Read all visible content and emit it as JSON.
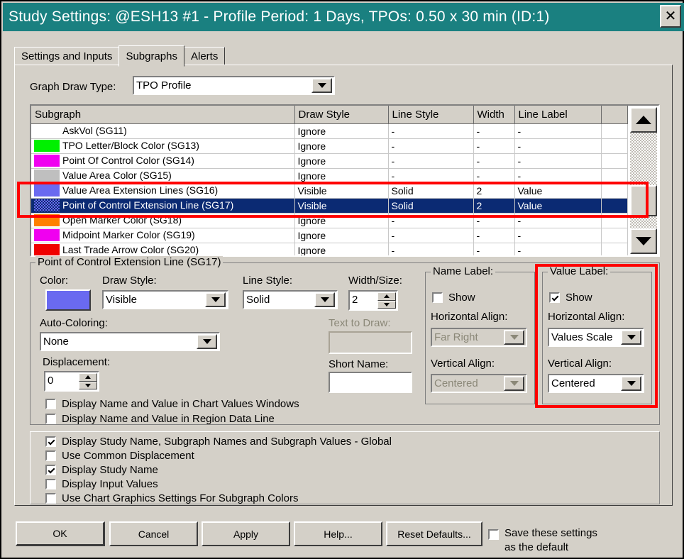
{
  "window": {
    "title": "Study Settings: @ESH13  #1 - Profile Period: 1 Days, TPOs: 0.50 x 30 min   (ID:1)",
    "close_label": "✕"
  },
  "tabs": [
    {
      "label": "Settings and Inputs",
      "active": false
    },
    {
      "label": "Subgraphs",
      "active": true
    },
    {
      "label": "Alerts",
      "active": false
    }
  ],
  "graph_draw_type": {
    "label": "Graph Draw Type:",
    "value": "TPO Profile"
  },
  "table": {
    "headers": [
      "Subgraph",
      "Draw Style",
      "Line Style",
      "Width",
      "Line Label",
      ""
    ],
    "rows": [
      {
        "swatch": "",
        "name": "AskVol (SG11)",
        "draw_style": "Ignore",
        "line_style": "-",
        "width": "-",
        "line_label": "-",
        "extra": "",
        "selected": false
      },
      {
        "swatch": "#00f000",
        "name": "TPO Letter/Block Color (SG13)",
        "draw_style": "Ignore",
        "line_style": "-",
        "width": "-",
        "line_label": "-",
        "extra": "",
        "selected": false
      },
      {
        "swatch": "#f000f0",
        "name": "Point Of Control Color (SG14)",
        "draw_style": "Ignore",
        "line_style": "-",
        "width": "-",
        "line_label": "-",
        "extra": "",
        "selected": false
      },
      {
        "swatch": "#bfbfbf",
        "name": "Value Area Color (SG15)",
        "draw_style": "Ignore",
        "line_style": "-",
        "width": "-",
        "line_label": "-",
        "extra": "",
        "selected": false
      },
      {
        "swatch": "#6a6af0",
        "name": "Value Area Extension Lines (SG16)",
        "draw_style": "Visible",
        "line_style": "Solid",
        "width": "2",
        "line_label": "Value",
        "extra": "",
        "selected": false
      },
      {
        "swatch": "#6a6af0",
        "name": "Point of Control Extension Line (SG17)",
        "draw_style": "Visible",
        "line_style": "Solid",
        "width": "2",
        "line_label": "Value",
        "extra": "",
        "selected": true
      },
      {
        "swatch": "#ff8000",
        "name": "Open Marker Color (SG18)",
        "draw_style": "Ignore",
        "line_style": "-",
        "width": "-",
        "line_label": "-",
        "extra": "",
        "selected": false
      },
      {
        "swatch": "#f000f0",
        "name": "Midpoint Marker Color (SG19)",
        "draw_style": "Ignore",
        "line_style": "-",
        "width": "-",
        "line_label": "-",
        "extra": "",
        "selected": false
      },
      {
        "swatch": "#f00000",
        "name": "Last Trade Arrow Color (SG20)",
        "draw_style": "Ignore",
        "line_style": "-",
        "width": "-",
        "line_label": "-",
        "extra": "",
        "selected": false
      }
    ]
  },
  "subgraph_panel": {
    "title": "Point of Control Extension Line (SG17)",
    "color_label": "Color:",
    "color_value": "#6a6af0",
    "draw_style_label": "Draw Style:",
    "draw_style_value": "Visible",
    "line_style_label": "Line Style:",
    "line_style_value": "Solid",
    "width_size_label": "Width/Size:",
    "width_size_value": "2",
    "auto_coloring_label": "Auto-Coloring:",
    "auto_coloring_value": "None",
    "displacement_label": "Displacement:",
    "displacement_value": "0",
    "text_to_draw_label": "Text to Draw:",
    "text_to_draw_value": "",
    "short_name_label": "Short Name:",
    "short_name_value": "",
    "checkboxes": [
      {
        "label": "Display Name and Value in Chart Values Windows",
        "checked": false
      },
      {
        "label": "Display Name and Value in Region Data Line",
        "checked": false
      }
    ]
  },
  "name_label": {
    "title": "Name Label:",
    "show_label": "Show",
    "show_checked": false,
    "horizontal_align_label": "Horizontal Align:",
    "horizontal_align_value": "Far Right",
    "vertical_align_label": "Vertical Align:",
    "vertical_align_value": "Centered",
    "enabled": false
  },
  "value_label": {
    "title": "Value Label:",
    "show_label": "Show",
    "show_checked": true,
    "horizontal_align_label": "Horizontal Align:",
    "horizontal_align_value": "Values Scale",
    "vertical_align_label": "Vertical Align:",
    "vertical_align_value": "Centered",
    "enabled": true
  },
  "global_checkboxes": [
    {
      "label": "Display Study Name, Subgraph Names and Subgraph Values - Global",
      "checked": true
    },
    {
      "label": "Use Common Displacement",
      "checked": false
    },
    {
      "label": "Display Study Name",
      "checked": true
    },
    {
      "label": "Display Input Values",
      "checked": false
    },
    {
      "label": "Use Chart Graphics Settings For Subgraph Colors",
      "checked": false
    }
  ],
  "buttons": {
    "ok": "OK",
    "cancel": "Cancel",
    "apply": "Apply",
    "help": "Help...",
    "reset": "Reset Defaults..."
  },
  "save_default": {
    "line1": "Save these settings",
    "line2": "as the default",
    "checked": false
  },
  "annotations": {
    "accent": "#ff0000",
    "title_bar_color": "#1a8080",
    "selection_color": "#0b2a73",
    "face_color": "#d4d0c8"
  }
}
